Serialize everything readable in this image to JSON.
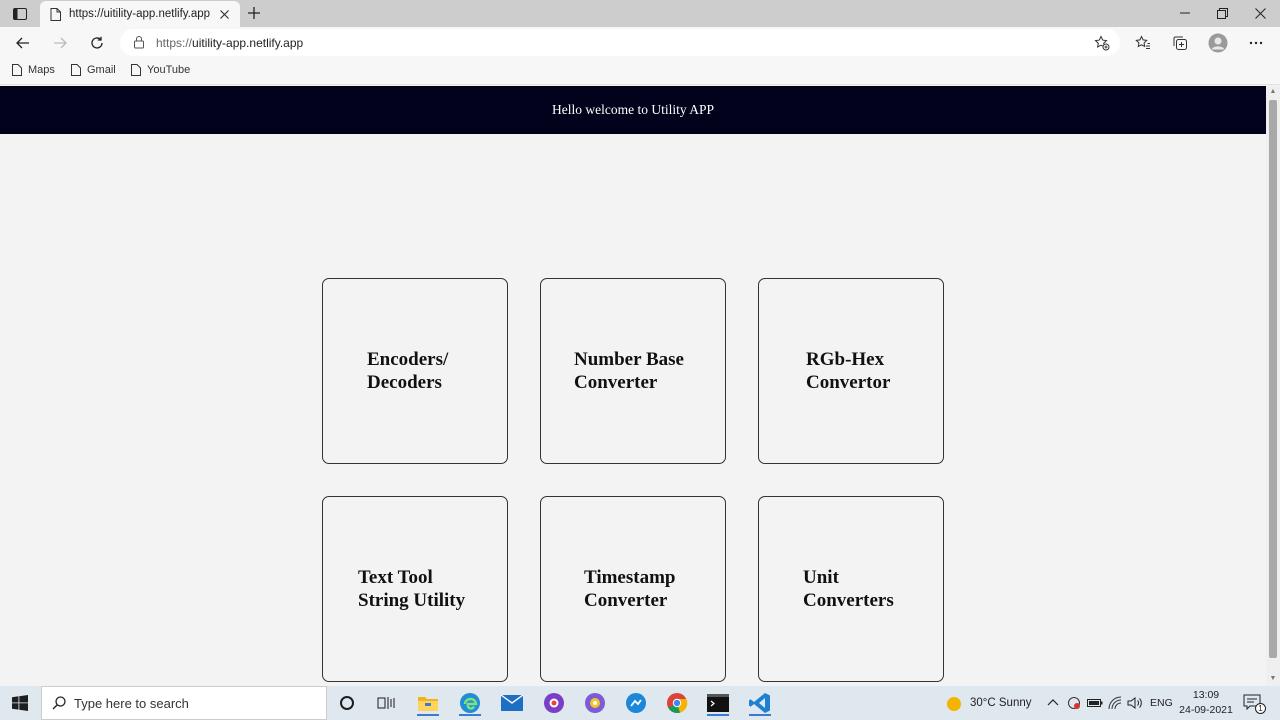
{
  "browser": {
    "tab_title": "https://uitility-app.netlify.app",
    "url_scheme": "https://",
    "url_host": "uitility-app.netlify.app",
    "bookmarks": [
      "Maps",
      "Gmail",
      "YouTube"
    ]
  },
  "page": {
    "header_text": "Hello welcome to Utility APP",
    "cards": [
      {
        "line1": "Encoders/",
        "line2": "Decoders"
      },
      {
        "line1": "Number Base",
        "line2": "Converter"
      },
      {
        "line1": "RGb-Hex",
        "line2": "Convertor"
      },
      {
        "line1": "Text Tool",
        "line2": "String Utility"
      },
      {
        "line1": "Timestamp",
        "line2": "Converter"
      },
      {
        "line1": "Unit",
        "line2": "Converters"
      }
    ]
  },
  "taskbar": {
    "search_placeholder": "Type here to search",
    "weather": "30°C  Sunny",
    "language": "ENG",
    "time": "13:09",
    "date": "24-09-2021",
    "notification_count": "1"
  },
  "colors": {
    "header_bg": "#02021c",
    "page_bg": "#f3f3f3",
    "card_border": "#333333"
  }
}
